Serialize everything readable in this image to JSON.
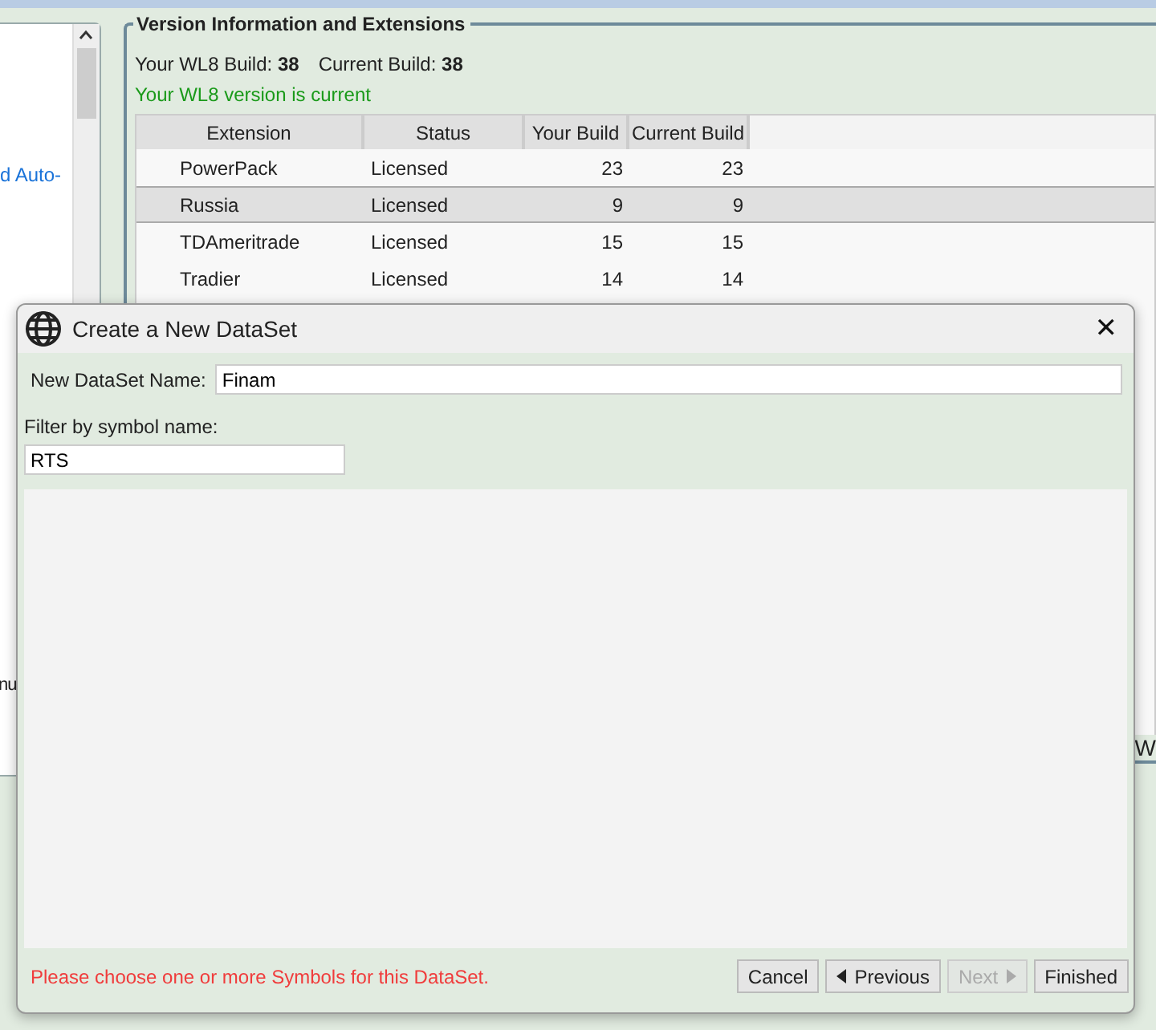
{
  "background": {
    "left_panel": {
      "link_text": "d Auto-",
      "text": "nu"
    },
    "right_edge_text": "W",
    "version_group": {
      "title": "Version Information and Extensions",
      "your_build": "Your WL8 Build: **38**",
      "current_build": "Current Build: **38**",
      "status": "Your WL8 version is current"
    },
    "table": {
      "columns": [
        "Extension",
        "Status",
        "Your Build",
        "Current Build"
      ],
      "rows": [
        {
          "cells": [
            "PowerPack",
            "Licensed",
            "23",
            "23"
          ],
          "selected": false
        },
        {
          "cells": [
            "Russia",
            "Licensed",
            "9",
            "9"
          ],
          "selected": true
        },
        {
          "cells": [
            "TDAmeritrade",
            "Licensed",
            "15",
            "15"
          ],
          "selected": false
        },
        {
          "cells": [
            "Tradier",
            "Licensed",
            "14",
            "14"
          ],
          "selected": false
        }
      ]
    }
  },
  "dialog": {
    "title": "Create a New DataSet",
    "close": "✕",
    "name_label": "New DataSet Name:",
    "name_value": "Finam",
    "filter_label": "Filter by symbol name:",
    "filter_value": "RTS",
    "message": "Please choose one or more Symbols for this DataSet.",
    "buttons": [
      {
        "label": "Cancel",
        "kind": "plain",
        "disabled": false
      },
      {
        "label": "Previous",
        "kind": "back",
        "disabled": false
      },
      {
        "label": "Next",
        "kind": "forward",
        "disabled": true
      },
      {
        "label": "Finished",
        "kind": "plain",
        "disabled": false
      }
    ]
  }
}
